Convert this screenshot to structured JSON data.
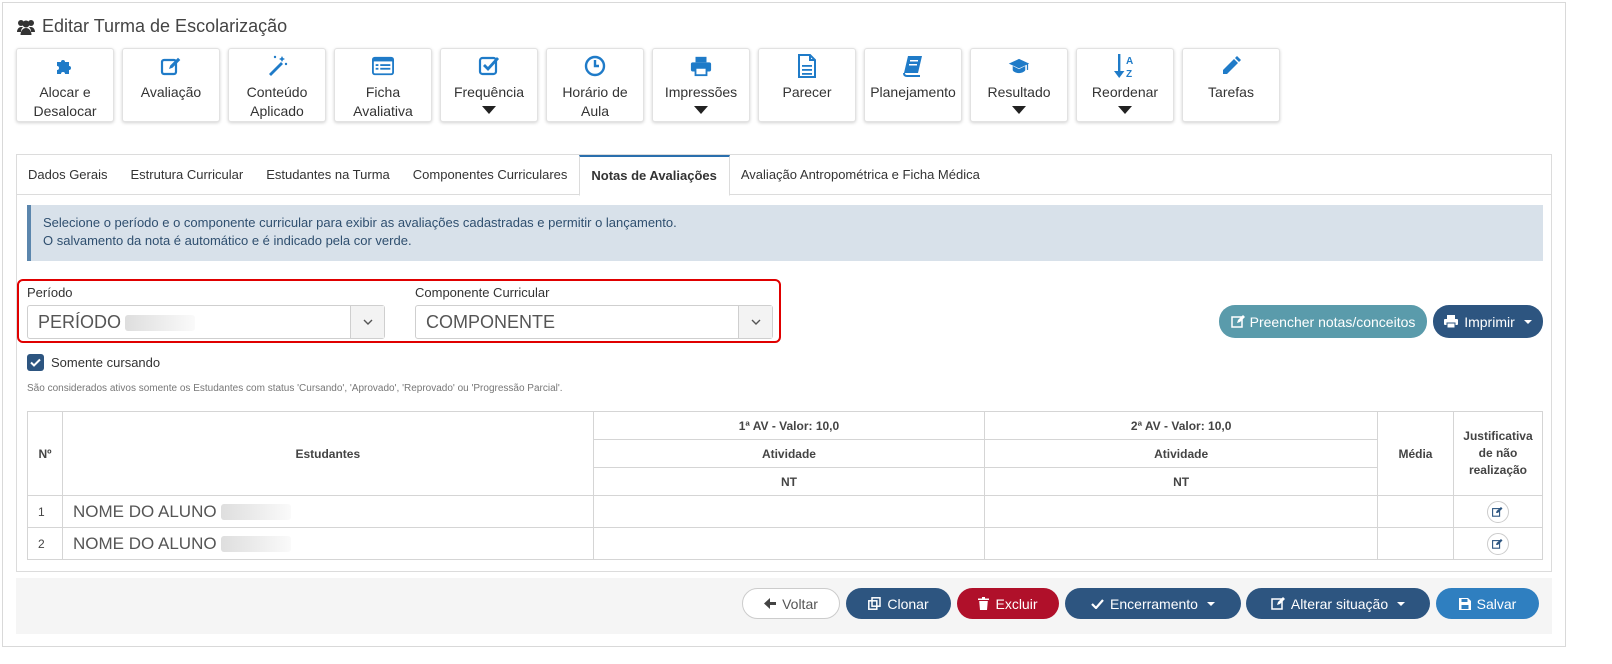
{
  "page_title": "Editar Turma de Escolarização",
  "toolbar": [
    {
      "label": "Alocar e\nDesalocar",
      "icon": "puzzle-icon",
      "dropdown": false
    },
    {
      "label": "Avaliação",
      "icon": "edit-icon",
      "dropdown": false
    },
    {
      "label": "Conteúdo\nAplicado",
      "icon": "magic-wand-icon",
      "dropdown": false
    },
    {
      "label": "Ficha\nAvaliativa",
      "icon": "list-alt-icon",
      "dropdown": false
    },
    {
      "label": "Frequência",
      "icon": "check-square-icon",
      "dropdown": true
    },
    {
      "label": "Horário de\nAula",
      "icon": "clock-icon",
      "dropdown": false
    },
    {
      "label": "Impressões",
      "icon": "printer-icon",
      "dropdown": true
    },
    {
      "label": "Parecer",
      "icon": "file-text-icon",
      "dropdown": false
    },
    {
      "label": "Planejamento",
      "icon": "book-icon",
      "dropdown": false
    },
    {
      "label": "Resultado",
      "icon": "graduation-cap-icon",
      "dropdown": true
    },
    {
      "label": "Reordenar",
      "icon": "sort-alpha-icon",
      "dropdown": true
    },
    {
      "label": "Tarefas",
      "icon": "pencil-icon",
      "dropdown": false
    }
  ],
  "tabs": [
    {
      "label": "Dados Gerais",
      "active": false
    },
    {
      "label": "Estrutura Curricular",
      "active": false
    },
    {
      "label": "Estudantes na Turma",
      "active": false
    },
    {
      "label": "Componentes Curriculares",
      "active": false
    },
    {
      "label": "Notas de Avaliações",
      "active": true
    },
    {
      "label": "Avaliação Antropométrica e Ficha Médica",
      "active": false
    }
  ],
  "alert": {
    "line1": "Selecione o período e o componente curricular para exibir as avaliações cadastradas e permitir o lançamento.",
    "line2": "O salvamento da nota é automático e é indicado pela cor verde."
  },
  "filters": {
    "period_label": "Período",
    "period_value": "PERÍODO",
    "component_label": "Componente Curricular",
    "component_value": "COMPONENTE"
  },
  "actions": {
    "fill_label": "Preencher notas/conceitos",
    "print_label": "Imprimir"
  },
  "only_enrolled": {
    "label": "Somente cursando",
    "checked": true,
    "note": "São considerados ativos somente os Estudantes com status 'Cursando', 'Aprovado', 'Reprovado' ou 'Progressão Parcial'."
  },
  "table": {
    "col_num": "Nº",
    "col_students": "Estudantes",
    "av1": "1ª AV - Valor: 10,0",
    "av2": "2ª AV - Valor: 10,0",
    "activity": "Atividade",
    "nt": "NT",
    "col_media": "Média",
    "col_justification": "Justificativa de não realização",
    "rows": [
      {
        "num": "1",
        "name": "NOME DO ALUNO"
      },
      {
        "num": "2",
        "name": "NOME DO ALUNO"
      }
    ]
  },
  "footer": {
    "back": "Voltar",
    "clone": "Clonar",
    "delete": "Excluir",
    "closing": "Encerramento",
    "change_status": "Alterar situação",
    "save": "Salvar"
  },
  "colors": {
    "primary": "#2d5580",
    "teal": "#5a9bab",
    "danger": "#b0102a",
    "save": "#2f7fc0",
    "highlight_box": "#e00000",
    "icon_blue": "#1f7bc8"
  }
}
